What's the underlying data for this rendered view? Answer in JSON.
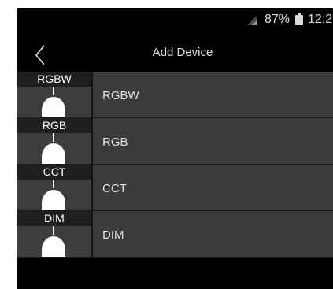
{
  "status_bar": {
    "battery": "87%",
    "time": "12:2",
    "signal_icon": "signal-icon",
    "battery_icon": "battery-icon"
  },
  "header": {
    "title": "Add Device",
    "back_icon": "chevron-left-icon"
  },
  "devices": [
    {
      "thumb_label": "RGBW",
      "name": "RGBW"
    },
    {
      "thumb_label": "RGB",
      "name": "RGB"
    },
    {
      "thumb_label": "CCT",
      "name": "CCT"
    },
    {
      "thumb_label": "DIM",
      "name": "DIM"
    }
  ],
  "colors": {
    "background": "#000000",
    "row": "#3b3b3b",
    "thumb": "#3d3d3d",
    "thumb_label_bg": "#1f1f1f",
    "text": "#e2e2e2"
  }
}
